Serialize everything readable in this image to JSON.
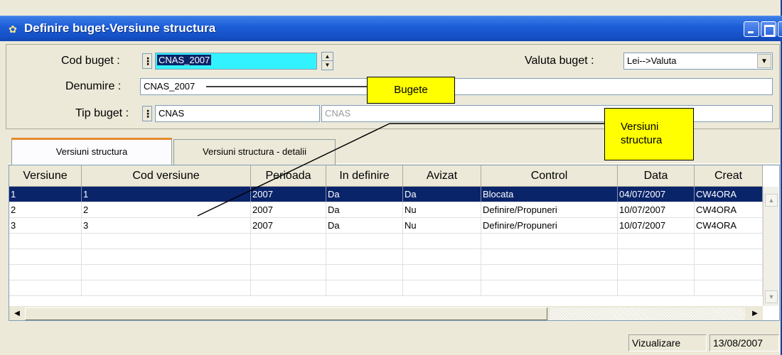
{
  "window": {
    "title": "Definire buget-Versiune structura"
  },
  "form": {
    "cod_buget_label": "Cod buget :",
    "cod_buget_value": "CNAS_2007",
    "valuta_buget_label": "Valuta buget :",
    "valuta_buget_value": "Lei-->Valuta",
    "denumire_label": "Denumire :",
    "denumire_value": "CNAS_2007",
    "tip_buget_label": "Tip buget :",
    "tip_buget_value": "CNAS",
    "tip_buget_desc": "CNAS"
  },
  "callouts": {
    "bugete": "Bugete",
    "versiuni_line1": "Versiuni",
    "versiuni_line2": "structura"
  },
  "tabs": [
    {
      "label": "Versiuni structura",
      "active": true
    },
    {
      "label": "Versiuni structura - detalii",
      "active": false
    }
  ],
  "grid": {
    "columns": [
      "Versiune",
      "Cod versiune",
      "Perioada",
      "In definire",
      "Avizat",
      "Control",
      "Data",
      "Creat"
    ],
    "rows": [
      [
        "1",
        "1",
        "2007",
        "Da",
        "Da",
        "Blocata",
        "04/07/2007",
        "CW4ORA"
      ],
      [
        "2",
        "2",
        "2007",
        "Da",
        "Nu",
        "Definire/Propuneri",
        "10/07/2007",
        "CW4ORA"
      ],
      [
        "3",
        "3",
        "2007",
        "Da",
        "Nu",
        "Definire/Propuneri",
        "10/07/2007",
        "CW4ORA"
      ]
    ],
    "selected_row": 0
  },
  "status": {
    "mode": "Vizualizare",
    "date": "13/08/2007"
  },
  "colors": {
    "titlebar": "#1d5fd8",
    "selection": "#0a246a",
    "cod_buget_highlight": "#33f2ff",
    "callout": "#ffff00"
  }
}
